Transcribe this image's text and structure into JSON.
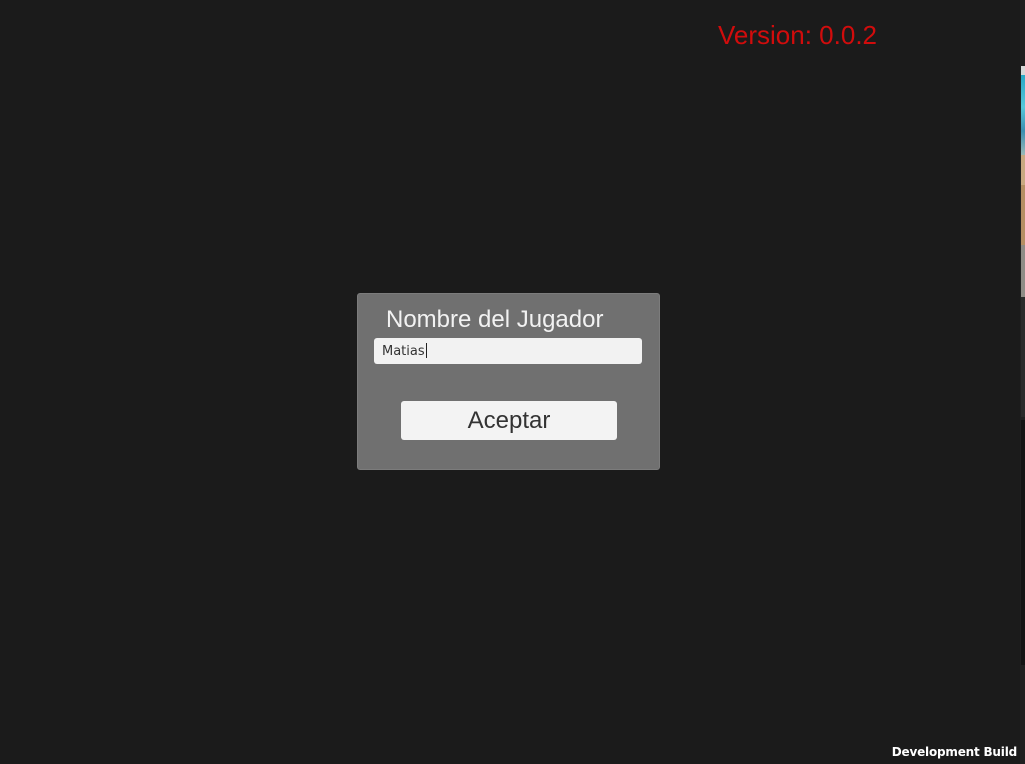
{
  "version_label": "Version: 0.0.2",
  "dialog": {
    "title": "Nombre del Jugador",
    "name_input": {
      "value": "Matias",
      "placeholder": ""
    },
    "accept_label": "Aceptar"
  },
  "footer": {
    "build_label": "Development Build"
  },
  "colors": {
    "background": "#1b1b1b",
    "version_text": "#d10c0c",
    "dialog_panel": "#707070",
    "input_background": "#f2f2f2",
    "button_background": "#f3f3f3"
  }
}
